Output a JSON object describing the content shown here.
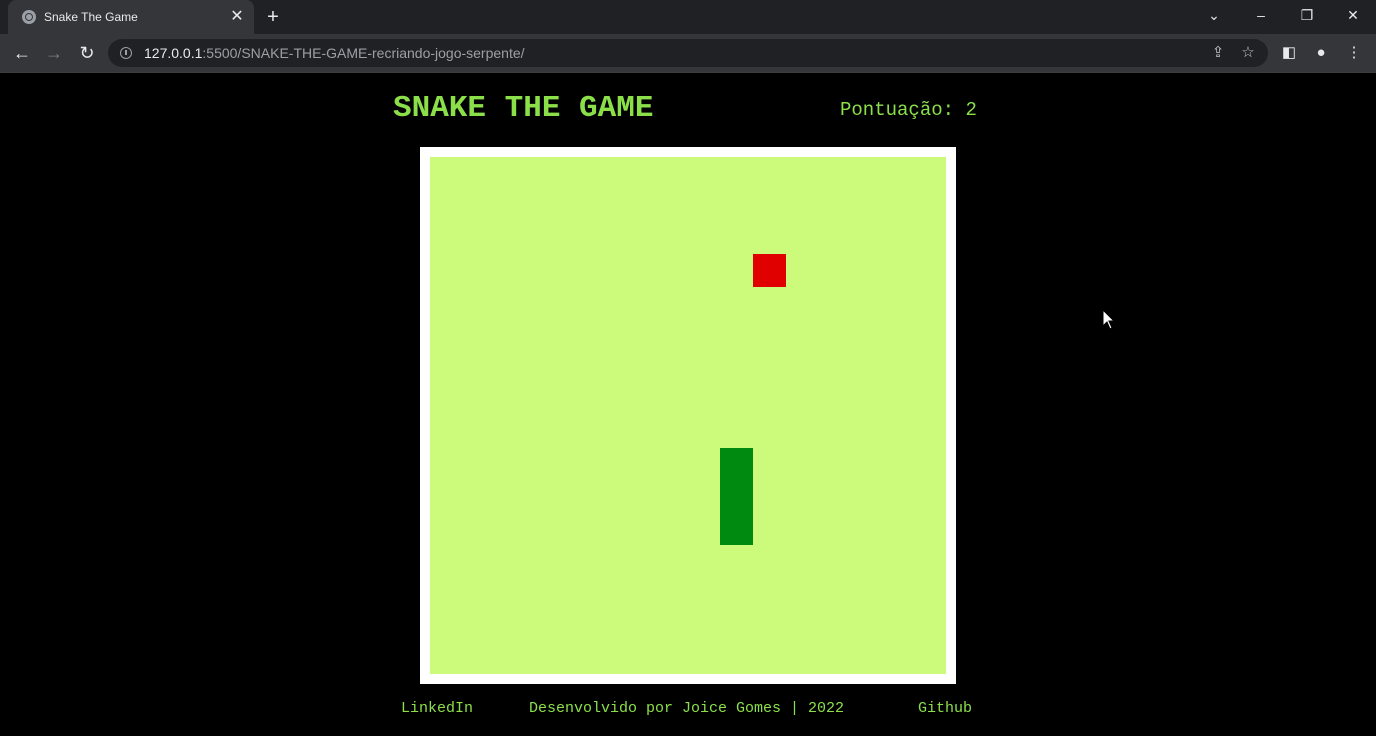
{
  "browser": {
    "tab_title": "Snake The Game",
    "new_tab_symbol": "+",
    "url_host": "127.0.0.1",
    "url_rest": ":5500/SNAKE-THE-GAME-recriando-jogo-serpente/",
    "icons": {
      "back": "back-arrow-icon",
      "forward": "forward-arrow-icon",
      "reload": "reload-icon",
      "site_info": "info-icon",
      "share": "share-icon",
      "bookmark": "star-icon",
      "side_panel": "side-panel-icon",
      "profile": "profile-icon",
      "menu": "kebab-menu-icon"
    }
  },
  "game": {
    "title": "SNAKE THE GAME",
    "score_label": "Pontuação:",
    "score_value": "2",
    "grid": {
      "columns": 16,
      "rows": 16
    },
    "food": {
      "col": 10,
      "row": 3
    },
    "snake": [
      {
        "col": 9,
        "row": 9
      },
      {
        "col": 9,
        "row": 10
      },
      {
        "col": 9,
        "row": 11
      }
    ],
    "colors": {
      "text": "#8be04a",
      "board": "#ccfb7b",
      "board_border": "#ffffff",
      "food": "#e00000",
      "snake": "#008b10"
    }
  },
  "footer": {
    "linkedin": "LinkedIn",
    "credit": "Desenvolvido por Joice Gomes | 2022",
    "github": "Github"
  }
}
